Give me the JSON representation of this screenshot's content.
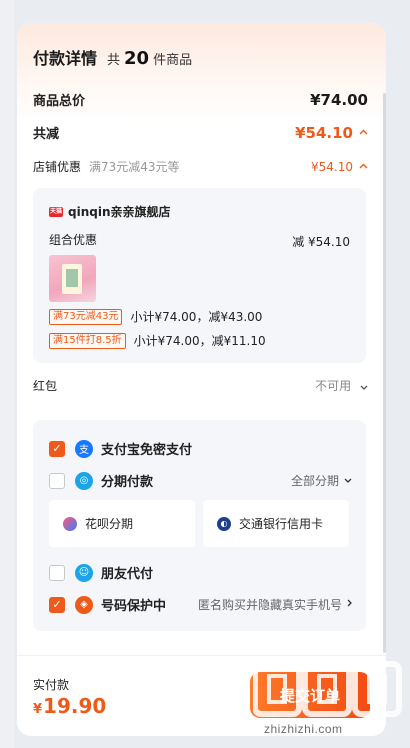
{
  "header": {
    "title": "付款详情",
    "count_prefix": "共",
    "count": "20",
    "count_suffix": "件商品"
  },
  "summary": {
    "total_label": "商品总价",
    "total_value": "¥74.00",
    "discount_label": "共减",
    "discount_value": "¥54.10",
    "shop_discount_label": "店铺优惠",
    "shop_discount_note": "满73元减43元等",
    "shop_discount_value": "¥54.10"
  },
  "shop": {
    "logo_text": "天猫",
    "name": "qinqin亲亲旗舰店",
    "combo_label": "组合优惠",
    "combo_value": "减 ¥54.10",
    "promos": [
      {
        "tag": "满73元减43元",
        "text": "小计¥74.00，减¥43.00"
      },
      {
        "tag": "满15件打8.5折",
        "text": "小计¥74.00，减¥11.10"
      }
    ]
  },
  "redpacket": {
    "label": "红包",
    "value": "不可用"
  },
  "payment": {
    "alipay_label": "支付宝免密支付",
    "installment_label": "分期付款",
    "installment_right": "全部分期",
    "huabei_label": "花呗分期",
    "bank_label": "交通银行信用卡",
    "friend_label": "朋友代付",
    "privacy_label": "号码保护中",
    "privacy_right": "匿名购买并隐藏真实手机号"
  },
  "footer": {
    "actual_label": "实付款",
    "currency": "¥",
    "actual_value": "19.90",
    "submit_label": "提交订单"
  },
  "watermark": {
    "logo_text": "值 值 值",
    "url": "zhizhizhi.com"
  },
  "colors": {
    "accent": "#ee5a1a",
    "card_bg": "#f4f6f9",
    "alipay_blue": "#1677ff"
  },
  "icons": {
    "discount_expand": "chevron-up-icon",
    "redpacket": "chevron-down-icon",
    "alipay": "alipay-icon",
    "installment": "installment-icon",
    "huabei": "huabei-icon",
    "bank": "bank-icon",
    "friend": "friend-pay-icon",
    "privacy": "shield-icon"
  }
}
